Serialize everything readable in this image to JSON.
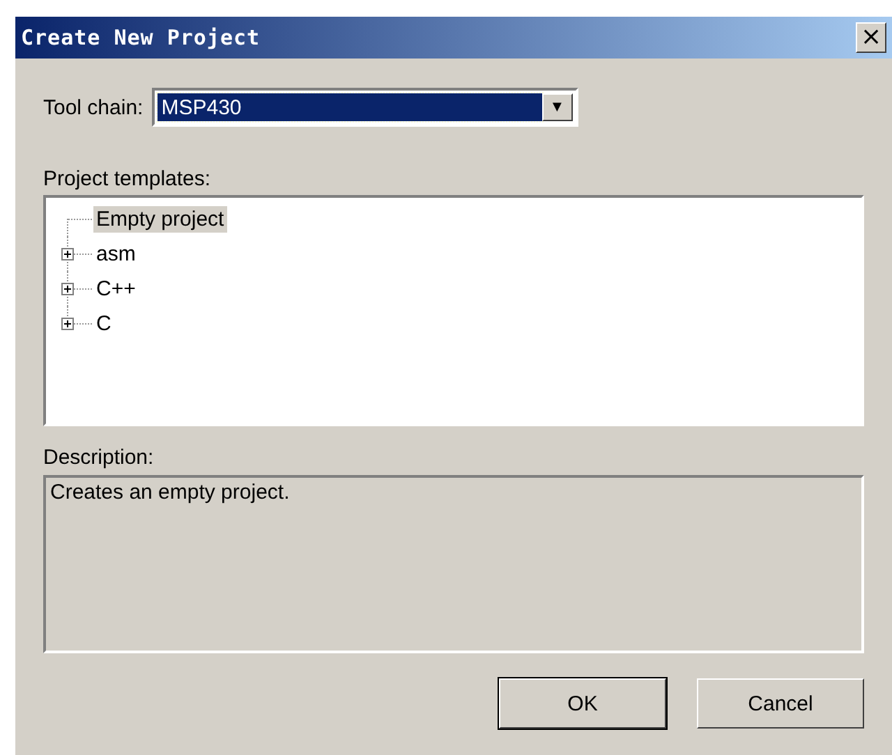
{
  "window": {
    "title": "Create New Project",
    "close": "×"
  },
  "tool_chain": {
    "label": "Tool chain:",
    "value": "MSP430",
    "focused": true,
    "arrow": "▼"
  },
  "templates": {
    "label": "Project templates:",
    "items": [
      {
        "label": "Empty project",
        "kind": "leaf",
        "selected": true
      },
      {
        "label": "asm",
        "kind": "group",
        "expanded": false,
        "selected": false
      },
      {
        "label": "C++",
        "kind": "group",
        "expanded": false,
        "selected": false
      },
      {
        "label": "C",
        "kind": "group",
        "expanded": false,
        "selected": false
      }
    ]
  },
  "description": {
    "label": "Description:",
    "text": "Creates an empty project."
  },
  "buttons": [
    {
      "label": "OK",
      "default": true
    },
    {
      "label": "Cancel",
      "default": false
    }
  ]
}
